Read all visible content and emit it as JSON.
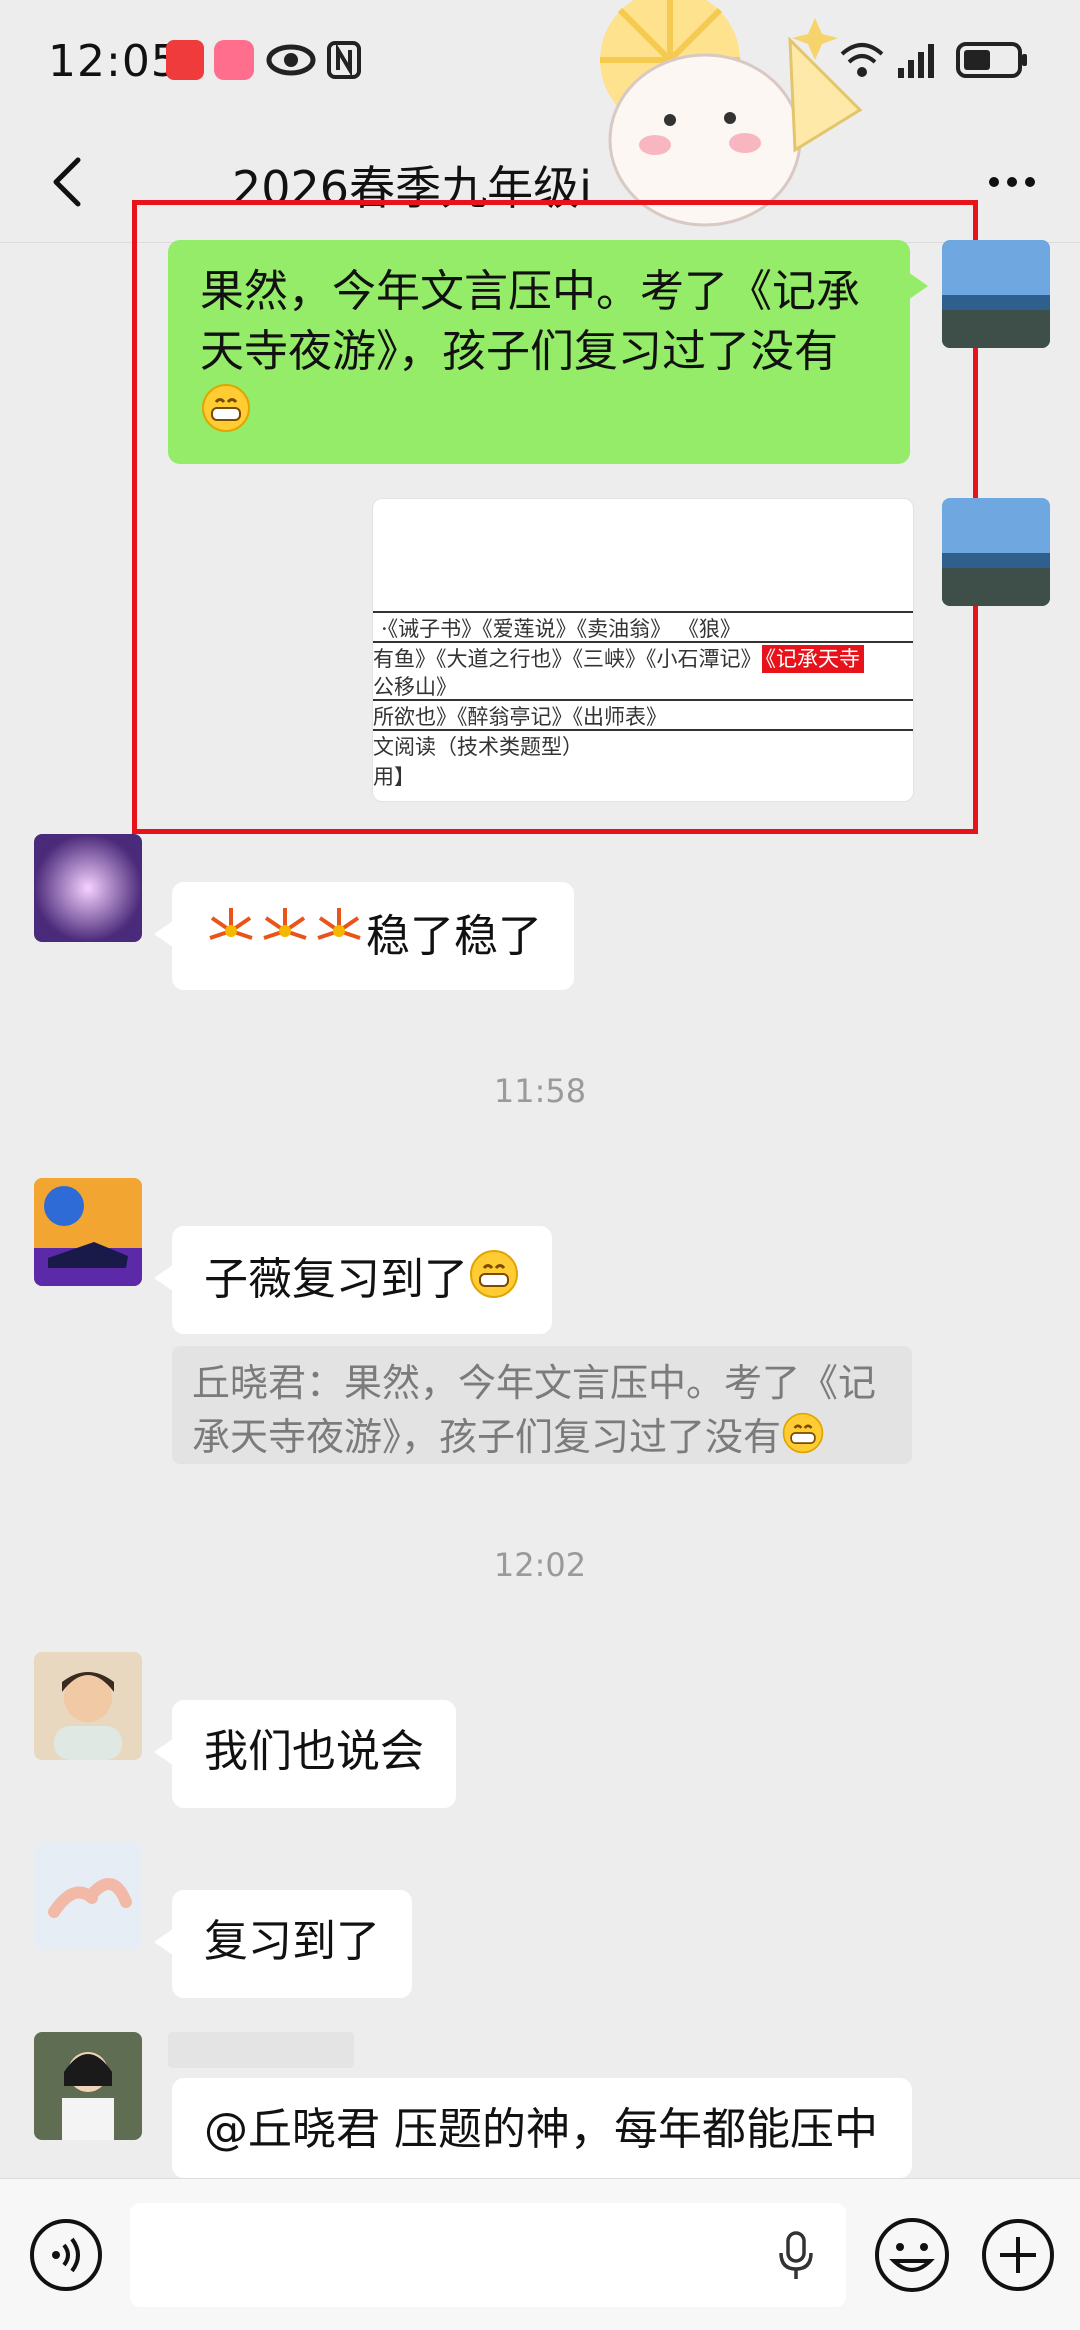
{
  "status": {
    "time": "12:05"
  },
  "header": {
    "title": "2026春季九年级i"
  },
  "messages": {
    "m1_text": "果然，今年文言压中。考了《记承天寺夜游》，孩子们复习过了没有",
    "m2_doc": {
      "row1": "·《诫子书》《爱莲说》《卖油翁》 《狼》",
      "row2_pre": "有鱼》《大道之行也》《三峡》《小石潭记》",
      "row2_highlight": "《记承天寺",
      "row3": "公移山》",
      "row4": "所欲也》《醉翁亭记》《出师表》",
      "row5": "文阅读（技术类题型）",
      "row6": "用】"
    },
    "m3_text": "稳了稳了",
    "time1": "11:58",
    "m4_text": "子薇复习到了",
    "m4_quote": "丘晓君：果然，今年文言压中。考了《记承天寺夜游》，孩子们复习过了没有",
    "time2": "12:02",
    "m5_text": "我们也说会",
    "m6_text": "复习到了",
    "m7_text": "@丘晓君  压题的神，每年都能压中"
  },
  "icons": {
    "back": "back-arrow-icon",
    "more": "more-icon",
    "voice": "voice-icon",
    "mic": "mic-icon",
    "emoji": "emoji-icon",
    "plus": "plus-icon"
  },
  "colors": {
    "bubble_self": "#95ec69",
    "bubble_other": "#ffffff",
    "background": "#ededed",
    "highlight_frame": "#e8121a"
  }
}
